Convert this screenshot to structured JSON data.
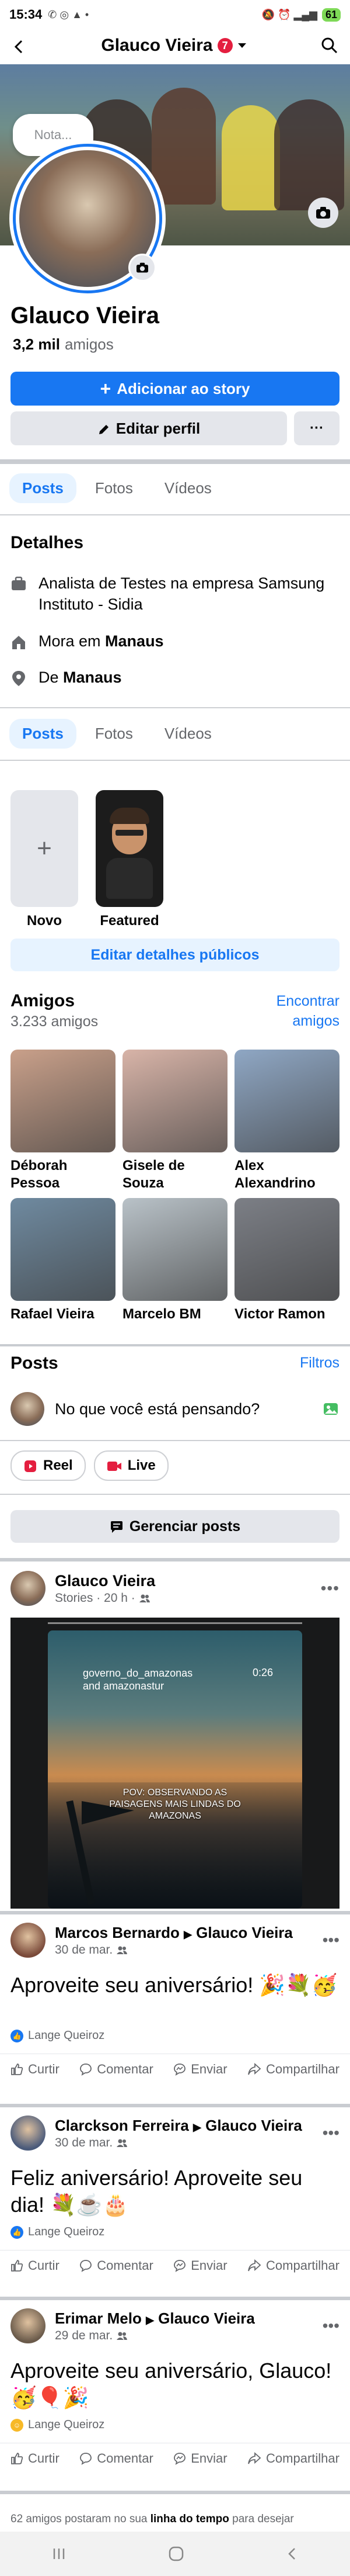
{
  "status_bar": {
    "time": "15:34",
    "battery": "61"
  },
  "top_bar": {
    "title": "Glauco Vieira",
    "badge_count": "7"
  },
  "profile": {
    "note_placeholder": "Nota...",
    "name": "Glauco Vieira",
    "friends_count": "3,2 mil",
    "friends_word": "amigos",
    "add_story_label": "Adicionar ao story",
    "edit_profile_label": "Editar perfil",
    "more_label": "···"
  },
  "tabs_top": [
    "Posts",
    "Fotos",
    "Vídeos"
  ],
  "details": {
    "title": "Detalhes",
    "work": "Analista de Testes na empresa Samsung Instituto - Sidia",
    "lives_prefix": "Mora em",
    "lives_city": "Manaus",
    "from_prefix": "De",
    "from_city": "Manaus"
  },
  "tabs_mid": [
    "Posts",
    "Fotos",
    "Vídeos"
  ],
  "featured": {
    "new_label": "Novo",
    "featured_label": "Featured",
    "edit_public_details": "Editar detalhes públicos"
  },
  "friends": {
    "title": "Amigos",
    "count_label": "3.233 amigos",
    "find_label": "Encontrar amigos",
    "items": [
      {
        "name": "Déborah Pessoa",
        "color": "#c9a08a"
      },
      {
        "name": "Gisele de Souza",
        "color": "#d8b4a8"
      },
      {
        "name": "Alex Alexandrino",
        "color": "#8fa7c4"
      },
      {
        "name": "Rafael Vieira",
        "color": "#6f8aa0"
      },
      {
        "name": "Marcelo BM",
        "color": "#b9c2c8"
      },
      {
        "name": "Victor Ramon",
        "color": "#7c7f86"
      }
    ]
  },
  "posts_section": {
    "title": "Posts",
    "filters_label": "Filtros",
    "composer_placeholder": "No que você está pensando?",
    "reel_label": "Reel",
    "live_label": "Live",
    "manage_label": "Gerenciar posts"
  },
  "story_post": {
    "author": "Glauco Vieira",
    "meta": "Stories · 20 h ·",
    "story_account": "governo_do_amazonas and amazonastur",
    "story_time": "0:26",
    "story_caption": "POV: OBSERVANDO AS PAISAGENS MAIS LINDAS DO AMAZONAS"
  },
  "posts": [
    {
      "author": "Marcos Bernardo",
      "target": "Glauco Vieira",
      "date": "30 de mar.",
      "text": "Aproveite seu aniversário! 🎉💐🥳",
      "reactor": "Lange Queiroz"
    },
    {
      "author": "Clarckson Ferreira",
      "target": "Glauco Vieira",
      "date": "30 de mar.",
      "text": "Feliz aniversário! Aproveite seu dia! 💐☕🎂",
      "reactor": "Lange Queiroz"
    },
    {
      "author": "Erimar Melo",
      "target": "Glauco Vieira",
      "date": "29 de mar.",
      "text": "Aproveite seu aniversário, Glauco! 🥳🎈🎉",
      "reactor": "Lange Queiroz"
    }
  ],
  "post_actions": {
    "like": "Curtir",
    "comment": "Comentar",
    "send": "Enviar",
    "share": "Compartilhar"
  },
  "footer_note": {
    "prefix": "62 amigos postaram no sua",
    "bold": "linha do tempo",
    "suffix": "para desejar"
  },
  "colors": {
    "accent": "#1877f2",
    "badge": "#e41e3f",
    "text": "#050505",
    "muted": "#65676b"
  }
}
